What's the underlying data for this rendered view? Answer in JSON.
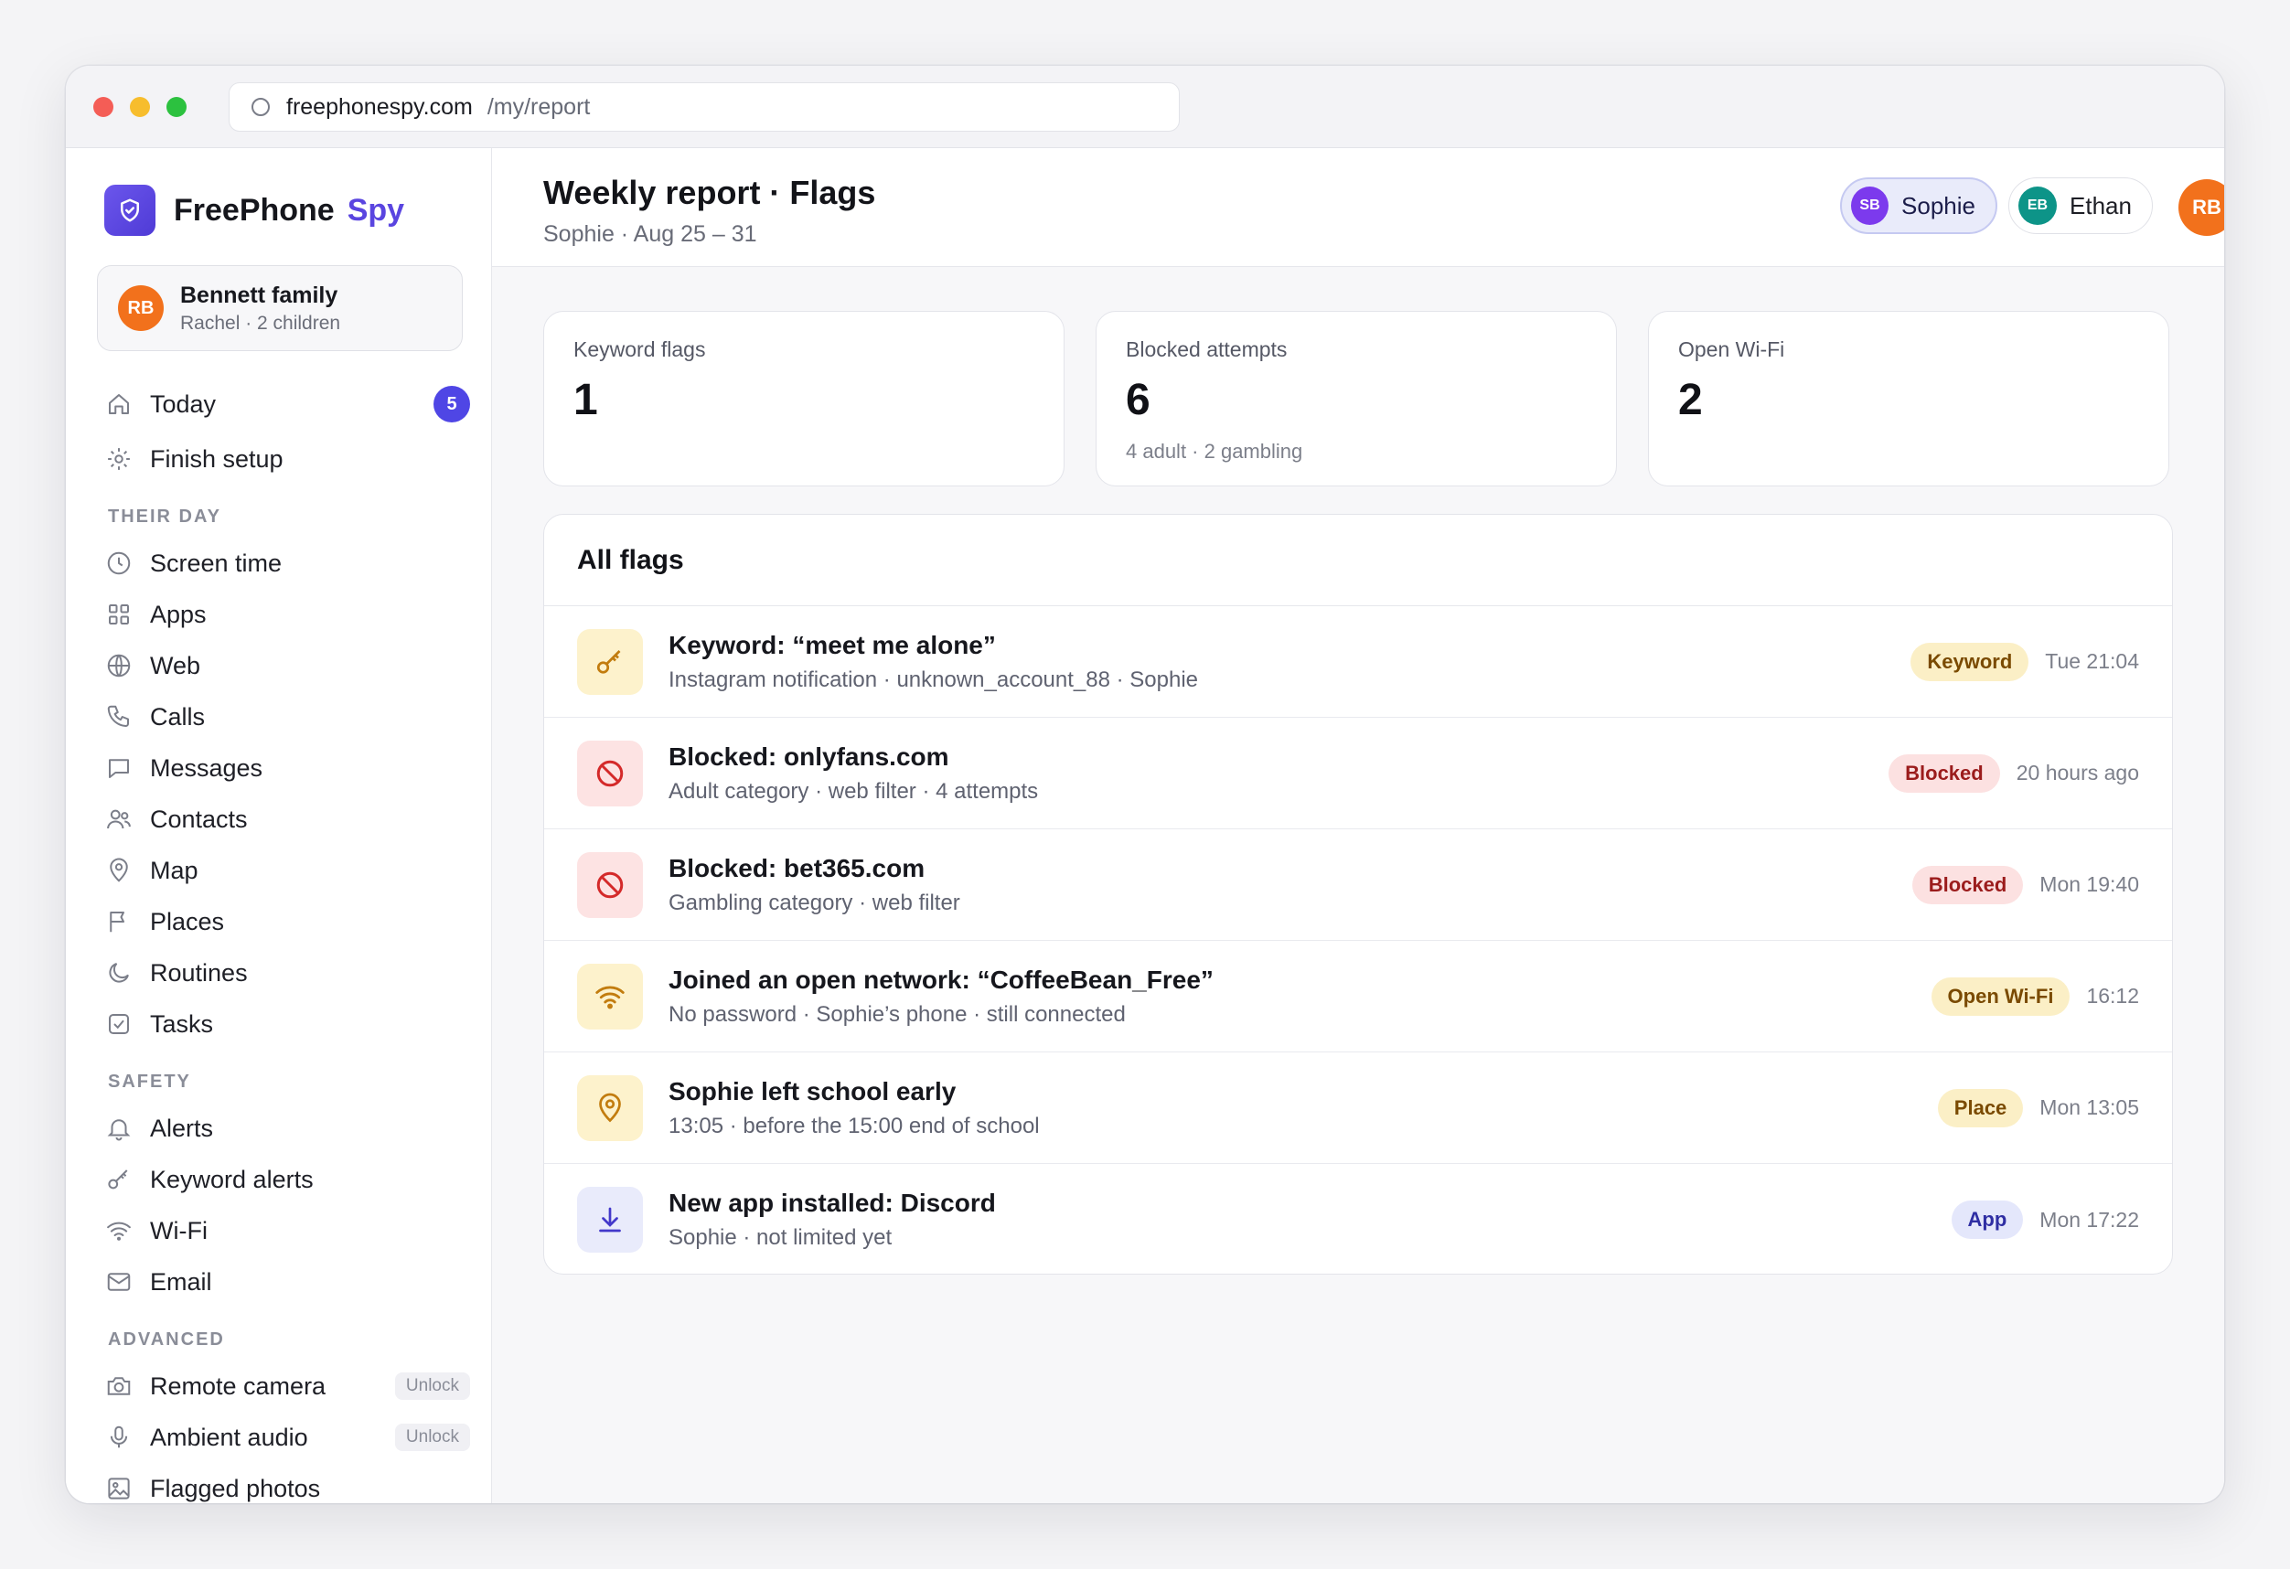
{
  "browser": {
    "domain": "freephonespy.com",
    "path": "/my/report"
  },
  "brand": {
    "name": "FreePhone",
    "accent": "Spy"
  },
  "family": {
    "initials": "RB",
    "name": "Bennett family",
    "sub": "Rachel · 2 children"
  },
  "nav": {
    "today": "Today",
    "today_badge": "5",
    "finish_setup": "Finish setup",
    "section_their_day": "THEIR DAY",
    "screen_time": "Screen time",
    "apps": "Apps",
    "web": "Web",
    "calls": "Calls",
    "messages": "Messages",
    "contacts": "Contacts",
    "map": "Map",
    "places": "Places",
    "routines": "Routines",
    "tasks": "Tasks",
    "section_safety": "SAFETY",
    "alerts": "Alerts",
    "keyword_alerts": "Keyword alerts",
    "wifi": "Wi-Fi",
    "email": "Email",
    "section_advanced": "ADVANCED",
    "remote_camera": "Remote camera",
    "ambient_audio": "Ambient audio",
    "flagged_photos": "Flagged photos",
    "unlock": "Unlock"
  },
  "header": {
    "title": "Weekly report · Flags",
    "sub": "Sophie · Aug 25 – 31",
    "kids": [
      {
        "initials": "SB",
        "name": "Sophie",
        "color": "#7c3aed"
      },
      {
        "initials": "EB",
        "name": "Ethan",
        "color": "#0d9488"
      }
    ],
    "user_initials": "RB"
  },
  "stats": [
    {
      "label": "Keyword flags",
      "value": "1",
      "note": ""
    },
    {
      "label": "Blocked attempts",
      "value": "6",
      "note": "4 adult · 2 gambling"
    },
    {
      "label": "Open Wi-Fi",
      "value": "2",
      "note": ""
    }
  ],
  "flags": {
    "title": "All flags",
    "rows": [
      {
        "title": "Keyword: “meet me alone”",
        "sub": "Instagram notification · unknown_account_88 · Sophie",
        "tag": "Keyword",
        "time": "Tue 21:04",
        "icon": "key-icon"
      },
      {
        "title": "Blocked: onlyfans.com",
        "sub": "Adult category · web filter · 4 attempts",
        "tag": "Blocked",
        "time": "20 hours ago",
        "icon": "blocked-icon"
      },
      {
        "title": "Blocked: bet365.com",
        "sub": "Gambling category · web filter",
        "tag": "Blocked",
        "time": "Mon 19:40",
        "icon": "blocked-icon"
      },
      {
        "title": "Joined an open network: “CoffeeBean_Free”",
        "sub": "No password · Sophie’s phone · still connected",
        "tag": "Open Wi-Fi",
        "time": "16:12",
        "icon": "wifi-icon"
      },
      {
        "title": "Sophie left school early",
        "sub": "13:05 · before the 15:00 end of school",
        "tag": "Place",
        "time": "Mon 13:05",
        "icon": "location-pin-icon"
      },
      {
        "title": "New app installed: Discord",
        "sub": "Sophie · not limited yet",
        "tag": "App",
        "time": "Mon 17:22",
        "icon": "download-icon"
      }
    ]
  },
  "colors": {
    "accent": "#4f46e5",
    "brand": "#5a45e0",
    "avatar": "#f2711c"
  }
}
